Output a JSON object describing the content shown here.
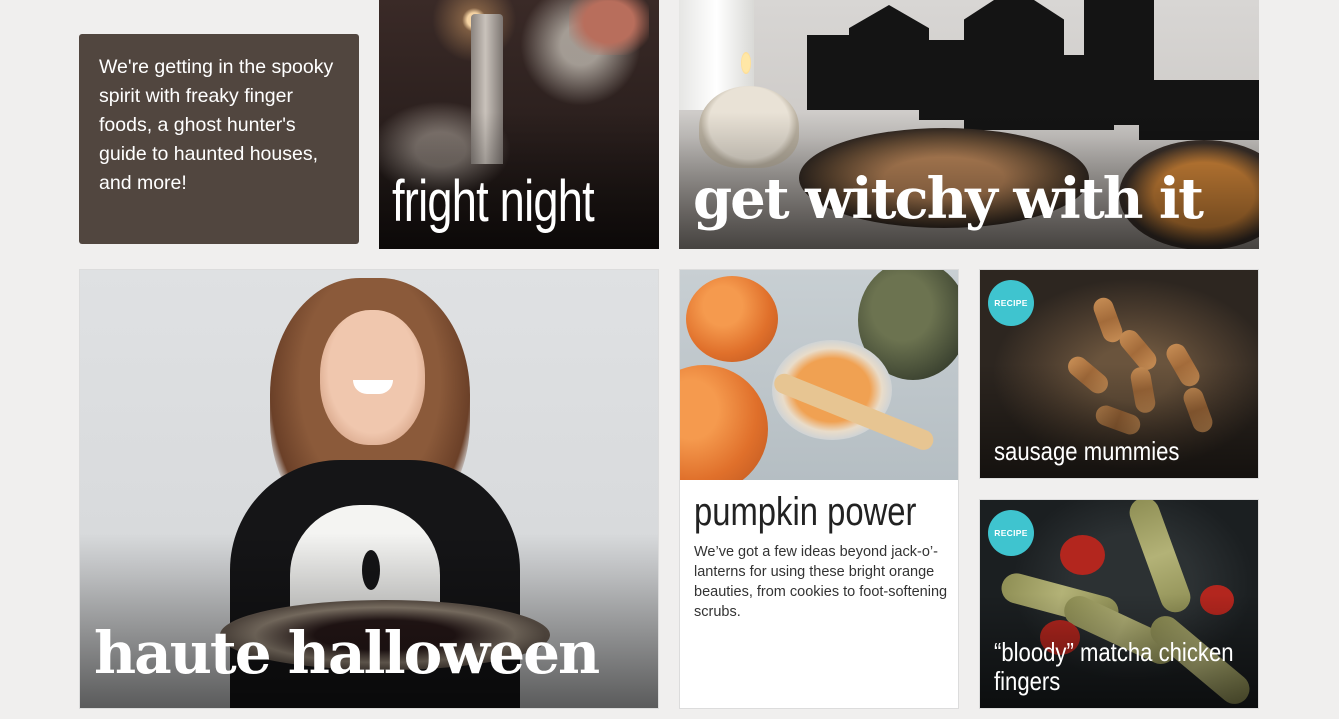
{
  "intro": {
    "text": "We're getting in the spooky spirit with freaky finger foods, a ghost hunter's guide to haunted houses, and more!"
  },
  "tiles": {
    "fright_night": {
      "title": "fright night"
    },
    "get_witchy": {
      "title": "get witchy with it"
    },
    "haute_halloween": {
      "title": "haute halloween"
    },
    "pumpkin_power": {
      "title": "pumpkin power",
      "description": "We’ve got a few ideas beyond jack-o’-lanterns for using these bright orange beauties, from cookies to foot-softening scrubs."
    },
    "sausage_mummies": {
      "badge": "RECIPE",
      "title": "sausage mummies"
    },
    "matcha_fingers": {
      "badge": "RECIPE",
      "title": "“bloody” matcha chicken fingers"
    }
  },
  "colors": {
    "page_background": "#f0efee",
    "intro_background": "#51463f",
    "recipe_badge": "#3fc4cf"
  }
}
